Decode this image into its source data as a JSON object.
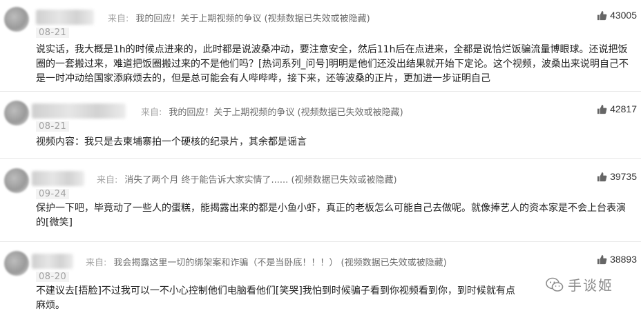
{
  "comments": [
    {
      "from_label": "来自:",
      "source": "我的回应！关于上期视频的争议 (视频数据已失效或被隐藏)",
      "date": "08-21",
      "likes": "43005",
      "text": "说实话，我大概是1h的时候点进来的，此时都是说波桑冲动，要注意安全，然后11h后在点进来，全都是说恰烂饭骗流量博眼球。还说把饭圈的一套搬过来，难道把饭圈搬过来的不是他们吗？[热词系列_问号]明明是他们还没出结果就开始下定论。这个视频，波桑出来说明自己不是一时冲动给国家添麻烦去的，但是总可能会有人哔哔哔，接下来，还等波桑的正片，更加进一步证明自己"
    },
    {
      "from_label": "来自:",
      "source": "我的回应！关于上期视频的争议 (视频数据已失效或被隐藏)",
      "date": "08-21",
      "likes": "42817",
      "text": "视频内容：我只是去柬埔寨拍一个硬核的纪录片，其余都是谣言"
    },
    {
      "from_label": "来自:",
      "source": "消失了两个月 终于能告诉大家实情了...... (视频数据已失效或被隐藏)",
      "date": "09-24",
      "likes": "39735",
      "text": "保护一下吧，毕竟动了一些人的蛋糕，能揭露出来的都是小鱼小虾，真正的老板怎么可能自己去做呢。就像捧艺人的资本家是不会上台表演的[微笑]"
    },
    {
      "from_label": "来自:",
      "source": "我会揭露这里一切的绑架案和诈骗（不是当卧底！！！） (视频数据已失效或被隐藏)",
      "date": "08-20",
      "likes": "38893",
      "text": "不建议去[捂脸]不过我可以一不小心控制他们电脑看他们[笑哭]我怕到时候骗子看到你视频看到你，到时候就有点麻烦。"
    }
  ],
  "watermark": {
    "text": "手谈姬",
    "icon": "wechat-logo-icon"
  },
  "colors": {
    "meta_gray": "#a3a3a3",
    "source_gray": "#6b6b6b",
    "text": "#222222"
  }
}
